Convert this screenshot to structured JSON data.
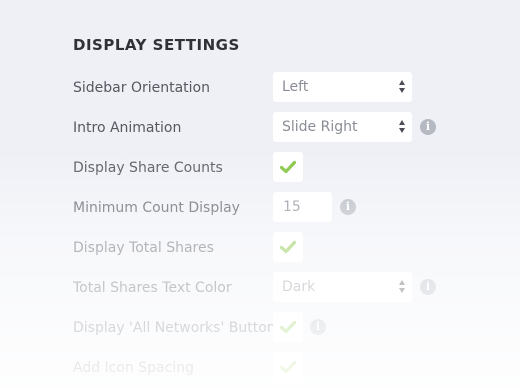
{
  "section": {
    "title": "DISPLAY SETTINGS"
  },
  "rows": [
    {
      "label": "Sidebar Orientation",
      "type": "select",
      "value": "Left"
    },
    {
      "label": "Intro Animation",
      "type": "select",
      "value": "Slide Right",
      "info": true
    },
    {
      "label": "Display Share Counts",
      "type": "checkbox",
      "checked": true
    },
    {
      "label": "Minimum Count Display",
      "type": "number",
      "value": "15",
      "info": true
    },
    {
      "label": "Display Total Shares",
      "type": "checkbox",
      "checked": true
    },
    {
      "label": "Total Shares Text Color",
      "type": "select",
      "value": "Dark",
      "info": true
    },
    {
      "label": "Display 'All Networks' Button",
      "type": "checkbox",
      "checked": true,
      "info": true
    },
    {
      "label": "Add Icon Spacing",
      "type": "checkbox",
      "checked": true
    }
  ],
  "icons": {
    "info": "info-icon",
    "check": "checkmark-icon",
    "arrows": "select-arrows-icon"
  },
  "colors": {
    "check_green": "#84c440",
    "info_gray": "#b5b9c2",
    "background": "#eef0f6"
  }
}
